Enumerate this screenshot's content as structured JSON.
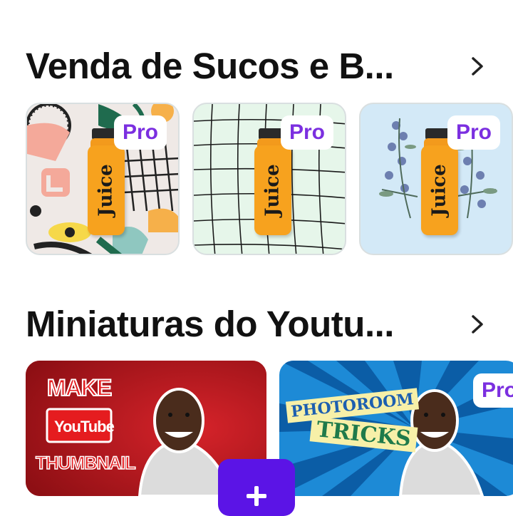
{
  "sections": [
    {
      "title": "Venda de Sucos e B...",
      "cards": [
        {
          "label": "Juice",
          "badge": "Pro"
        },
        {
          "label": "Juice",
          "badge": "Pro"
        },
        {
          "label": "Juice",
          "badge": "Pro"
        }
      ]
    },
    {
      "title": "Miniaturas do Youtu...",
      "cards": [
        {
          "line1": "MAKE",
          "line2": "YouTube",
          "line3": "THUMBNAIL"
        },
        {
          "line1": "PHOTOROOM",
          "line2": "TRICKS",
          "badge": "Pro"
        }
      ]
    }
  ],
  "colors": {
    "accent": "#5b14e6",
    "pro_text": "#7b2fe0",
    "youtube_red": "#c0191e"
  },
  "icons": [
    "chevron-right-icon",
    "plus-icon"
  ]
}
